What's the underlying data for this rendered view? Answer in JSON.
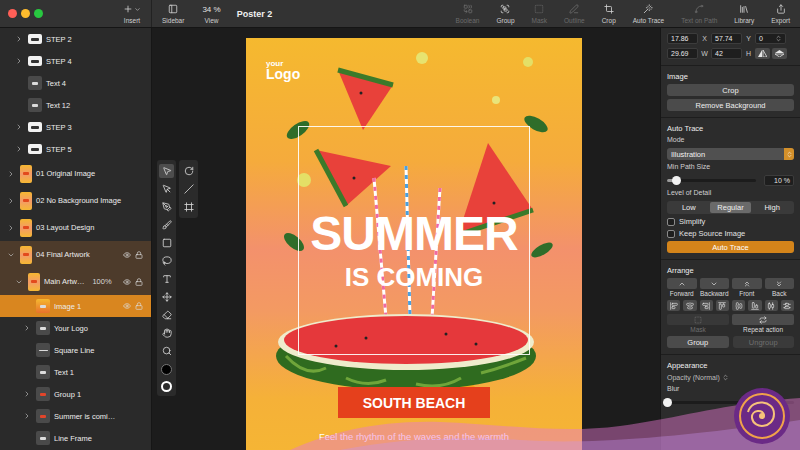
{
  "window": {
    "title": "Poster 2"
  },
  "toolbar": {
    "insert": {
      "label": "Insert"
    },
    "sidebar": {
      "label": "Sidebar"
    },
    "zoom": {
      "value": "34 %",
      "label": "View"
    },
    "actions": [
      {
        "label": "Boolean",
        "disabled": true
      },
      {
        "label": "Group",
        "disabled": false
      },
      {
        "label": "Mask",
        "disabled": true
      },
      {
        "label": "Outline",
        "disabled": true
      },
      {
        "label": "Crop",
        "disabled": false
      },
      {
        "label": "Auto Trace",
        "disabled": false
      },
      {
        "label": "Text on Path",
        "disabled": true
      },
      {
        "label": "Library",
        "disabled": false
      },
      {
        "label": "Export",
        "disabled": false
      }
    ]
  },
  "layers": [
    {
      "name": "STEP 2",
      "depth": 1,
      "kind": "step",
      "has_children": true,
      "expanded": false,
      "selected": false,
      "in_selection": false
    },
    {
      "name": "STEP 4",
      "depth": 1,
      "kind": "step",
      "has_children": true,
      "expanded": false,
      "selected": false,
      "in_selection": false
    },
    {
      "name": "Text 4",
      "depth": 1,
      "kind": "text",
      "has_children": false,
      "expanded": false,
      "selected": false,
      "in_selection": false
    },
    {
      "name": "Text 12",
      "depth": 1,
      "kind": "text",
      "has_children": false,
      "expanded": false,
      "selected": false,
      "in_selection": false
    },
    {
      "name": "STEP 3",
      "depth": 1,
      "kind": "step",
      "has_children": true,
      "expanded": false,
      "selected": false,
      "in_selection": false
    },
    {
      "name": "STEP 5",
      "depth": 1,
      "kind": "step",
      "has_children": true,
      "expanded": false,
      "selected": false,
      "in_selection": false
    },
    {
      "name": "01 Original Image",
      "depth": 0,
      "kind": "poster",
      "has_children": true,
      "expanded": false,
      "selected": false,
      "in_selection": false
    },
    {
      "name": "02 No Background Image",
      "depth": 0,
      "kind": "poster",
      "has_children": true,
      "expanded": false,
      "selected": false,
      "in_selection": false
    },
    {
      "name": "03 Layout Design",
      "depth": 0,
      "kind": "poster",
      "has_children": true,
      "expanded": false,
      "selected": false,
      "in_selection": false
    },
    {
      "name": "04 Final Artwork",
      "depth": 0,
      "kind": "poster",
      "has_children": true,
      "expanded": true,
      "selected": false,
      "in_selection": true
    },
    {
      "name": "Main Artw…",
      "depth": 1,
      "kind": "poster",
      "has_children": true,
      "expanded": true,
      "selected": false,
      "in_selection": true,
      "badge": "100%"
    },
    {
      "name": "Image 1",
      "depth": 2,
      "kind": "image",
      "has_children": false,
      "expanded": false,
      "selected": true,
      "in_selection": false
    },
    {
      "name": "Your Logo",
      "depth": 2,
      "kind": "logo",
      "has_children": true,
      "expanded": false,
      "selected": false,
      "in_selection": false
    },
    {
      "name": "Square Line",
      "depth": 2,
      "kind": "line",
      "has_children": false,
      "expanded": false,
      "selected": false,
      "in_selection": false
    },
    {
      "name": "Text 1",
      "depth": 2,
      "kind": "text",
      "has_children": false,
      "expanded": false,
      "selected": false,
      "in_selection": false
    },
    {
      "name": "Group 1",
      "depth": 2,
      "kind": "group",
      "has_children": true,
      "expanded": false,
      "selected": false,
      "in_selection": false
    },
    {
      "name": "Summer is comi…",
      "depth": 2,
      "kind": "group",
      "has_children": true,
      "expanded": false,
      "selected": false,
      "in_selection": false
    },
    {
      "name": "Line Frame",
      "depth": 2,
      "kind": "frame",
      "has_children": false,
      "expanded": false,
      "selected": false,
      "in_selection": false
    }
  ],
  "tools": {
    "left": [
      {
        "selected": true
      },
      {
        "selected": false
      },
      {
        "selected": false
      },
      {
        "selected": false
      },
      {
        "selected": false
      },
      {
        "selected": false
      },
      {
        "selected": false
      },
      {
        "selected": false
      },
      {
        "selected": false
      },
      {
        "selected": false
      },
      {
        "selected": false
      }
    ],
    "right": [
      {
        "selected": false
      },
      {
        "selected": false
      },
      {
        "selected": false
      }
    ],
    "fill": "#000000",
    "stroke": "#ffffff"
  },
  "poster": {
    "logo": {
      "small": "your",
      "large": "Logo"
    },
    "headline": "SUMMER",
    "subheadline": "IS COMING",
    "cta": "SOUTH BEACH",
    "body": "Feel the rhythm of the waves and the warmth"
  },
  "inspector": {
    "geometry": {
      "x": {
        "value": "17.86",
        "label": "X"
      },
      "y": {
        "value": "57.74",
        "label": "Y"
      },
      "rotation": {
        "value": "0"
      },
      "w": {
        "value": "29.69",
        "label": "W"
      },
      "h": {
        "value": "42",
        "label": "H"
      }
    },
    "image": {
      "title": "Image",
      "buttons": [
        "Crop",
        "Remove Background"
      ]
    },
    "auto_trace": {
      "title": "Auto Trace",
      "mode_label": "Mode",
      "mode_value": "Illustration",
      "min_path_label": "Min Path Size",
      "min_path_level": 0.1,
      "min_path_reading": "10 %",
      "detail_label": "Level of Detail",
      "detail_options": [
        {
          "label": "Low",
          "selected": false
        },
        {
          "label": "Regular",
          "selected": true
        },
        {
          "label": "High",
          "selected": false
        }
      ],
      "checkboxes": [
        {
          "label": "Simplify",
          "checked": false
        },
        {
          "label": "Keep Source Image",
          "checked": false
        }
      ],
      "button": "Auto Trace"
    },
    "arrange": {
      "title": "Arrange",
      "order": [
        "Forward",
        "Backward",
        "Front",
        "Back"
      ],
      "actions": [
        {
          "label": "Mask",
          "disabled": true
        },
        {
          "label": "Repeat action",
          "disabled": false
        }
      ],
      "buttons": [
        {
          "label": "Group",
          "disabled": false
        },
        {
          "label": "Ungroup",
          "disabled": true
        }
      ]
    },
    "appearance": {
      "title": "Appearance",
      "opacity": "Opacity (Normal)",
      "blur": "Blur",
      "blur_level": 0
    }
  }
}
